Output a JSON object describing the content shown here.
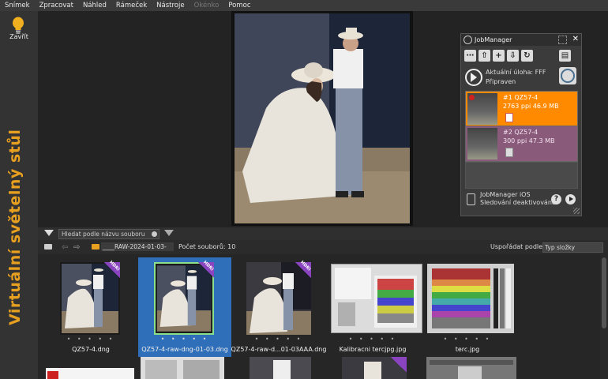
{
  "menu": {
    "items": [
      {
        "label": "Snímek",
        "disabled": false
      },
      {
        "label": "Zpracovat",
        "disabled": false
      },
      {
        "label": "Náhled",
        "disabled": false
      },
      {
        "label": "Rámeček",
        "disabled": false
      },
      {
        "label": "Nástroje",
        "disabled": false
      },
      {
        "label": "Okénko",
        "disabled": true
      },
      {
        "label": "Pomoc",
        "disabled": false
      }
    ]
  },
  "sidebar": {
    "close_label": "Zavřít",
    "vertical_title": "Virtuální světelný stůl"
  },
  "job_manager": {
    "title": "JobManager",
    "toolbar_icons": [
      "more-icon",
      "upload-icon",
      "add-icon",
      "download-icon",
      "refresh-icon",
      "clipboard-icon"
    ],
    "current_task_label": "Aktuální úloha: FFF",
    "status": "Připraven",
    "jobs": [
      {
        "name": "#1 QZ57-4",
        "details": "2763 ppi   46.9 MB"
      },
      {
        "name": "#2 QZ57-4",
        "details": "300 ppi   47.3 MB"
      }
    ],
    "ios_label": "JobManager iOS",
    "tracking_status": "Sledování deaktivováno",
    "help_symbol": "?"
  },
  "filter": {
    "search_placeholder": "Hledat podle názvu souboru"
  },
  "path_bar": {
    "folder": "____RAW-2024-01-03-",
    "file_count": "Počet souborů: 10",
    "sort_label": "Uspořádat podle",
    "sort_value": "Typ složky"
  },
  "thumbnails": [
    {
      "caption": "QZ57-4.dng",
      "hdr": true,
      "selected": false
    },
    {
      "caption": "QZ57-4-raw-dng-01-03.dng",
      "hdr": true,
      "selected": true
    },
    {
      "caption": "QZ57-4-raw-d...01-03AAA.dng",
      "hdr": true,
      "selected": false
    },
    {
      "caption": "Kalibracni tercjpg.jpg",
      "hdr": false,
      "selected": false
    },
    {
      "caption": "terc.jpg",
      "hdr": false,
      "selected": false
    }
  ],
  "hdr_badge": "HDRi",
  "dots": "• • • • •",
  "colors": {
    "accent_orange": "#ff8a00",
    "job2_bg": "#8a5a7a",
    "selected_blue": "#2f6fba",
    "title_orange": "#e8a020"
  }
}
